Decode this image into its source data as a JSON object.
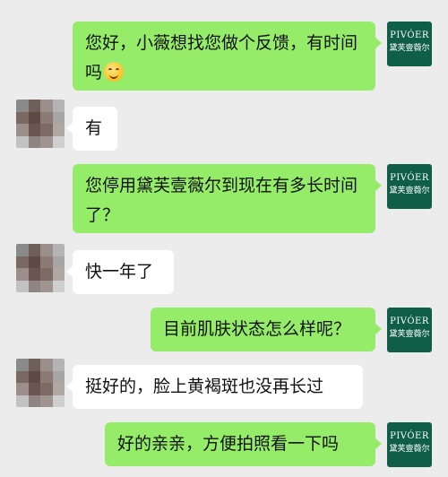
{
  "brand": {
    "name_en": "PIVÓER",
    "name_cn": "黛芙壹薇尔",
    "color": "#0f5e48"
  },
  "colors": {
    "background": "#ececec",
    "outgoing_bubble": "#95ec69",
    "incoming_bubble": "#ffffff"
  },
  "messages": [
    {
      "sender": "brand",
      "text": "您好，小薇想找您做个反馈，有时间吗",
      "emoji": "smiling-face"
    },
    {
      "sender": "user",
      "text": "有"
    },
    {
      "sender": "brand",
      "text": "您停用黛芙壹薇尔到现在有多长时间了？"
    },
    {
      "sender": "user",
      "text": "快一年了"
    },
    {
      "sender": "brand",
      "text": "目前肌肤状态怎么样呢？"
    },
    {
      "sender": "user",
      "text": "挺好的，脸上黄褐斑也没再长过"
    },
    {
      "sender": "brand",
      "text": "好的亲亲，方便拍照看一下吗"
    }
  ]
}
